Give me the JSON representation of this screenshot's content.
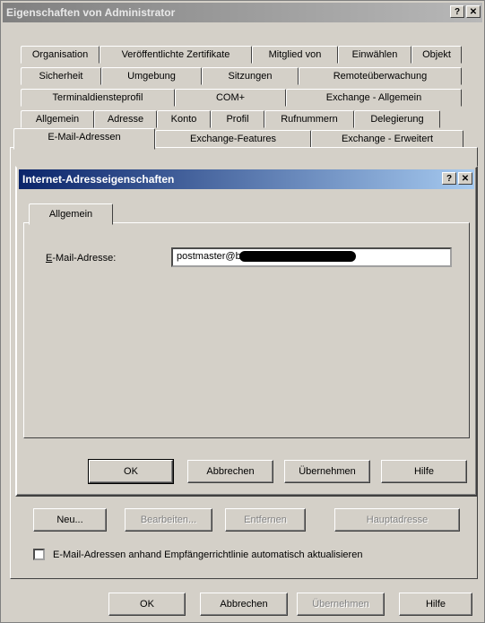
{
  "window": {
    "title": "Eigenschaften von Administrator",
    "help_btn": "?",
    "close_btn": "✕"
  },
  "tabs": {
    "row1": [
      "Organisation",
      "Veröffentlichte Zertifikate",
      "Mitglied von",
      "Einwählen",
      "Objekt"
    ],
    "row2": [
      "Sicherheit",
      "Umgebung",
      "Sitzungen",
      "Remoteüberwachung"
    ],
    "row3": [
      "Terminaldiensteprofil",
      "COM+",
      "Exchange - Allgemein"
    ],
    "row4": [
      "Allgemein",
      "Adresse",
      "Konto",
      "Profil",
      "Rufnummern",
      "Delegierung"
    ],
    "row5": [
      "E-Mail-Adressen",
      "Exchange-Features",
      "Exchange - Erweitert"
    ],
    "active": "E-Mail-Adressen"
  },
  "dialog": {
    "title": "Internet-Adresseigenschaften",
    "help_btn": "?",
    "close_btn": "✕",
    "tab": "Allgemein",
    "email_label": "E-Mail-Adresse:",
    "email_value": "postmaster@b",
    "buttons": {
      "ok": "OK",
      "cancel": "Abbrechen",
      "apply": "Übernehmen",
      "help": "Hilfe"
    }
  },
  "outer": {
    "buttons": {
      "new": "Neu...",
      "edit": "Bearbeiten...",
      "remove": "Entfernen",
      "primary": "Hauptadresse"
    },
    "checkbox_label": "E-Mail-Adressen anhand Empfängerrichtlinie automatisch aktualisieren",
    "checkbox_checked": false,
    "bottom": {
      "ok": "OK",
      "cancel": "Abbrechen",
      "apply": "Übernehmen",
      "help": "Hilfe"
    }
  }
}
